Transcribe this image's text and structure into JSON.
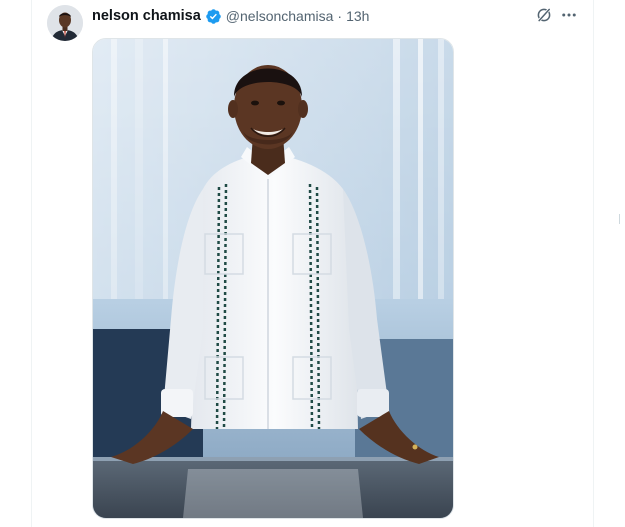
{
  "tweet": {
    "author": {
      "display_name": "nelson chamisa",
      "handle": "@nelsonchamisa",
      "verified": true
    },
    "separator": "·",
    "time": "13h",
    "media": {
      "type": "photo",
      "subject": "man in white embroidered shirt leaning on a table"
    }
  },
  "icons": {
    "verified": "verified-badge-icon",
    "grok": "grok-icon",
    "more": "more-horizontal-icon"
  },
  "colors": {
    "verified_blue": "#1d9bf0",
    "text_primary": "#0f1419",
    "text_secondary": "#536471"
  }
}
